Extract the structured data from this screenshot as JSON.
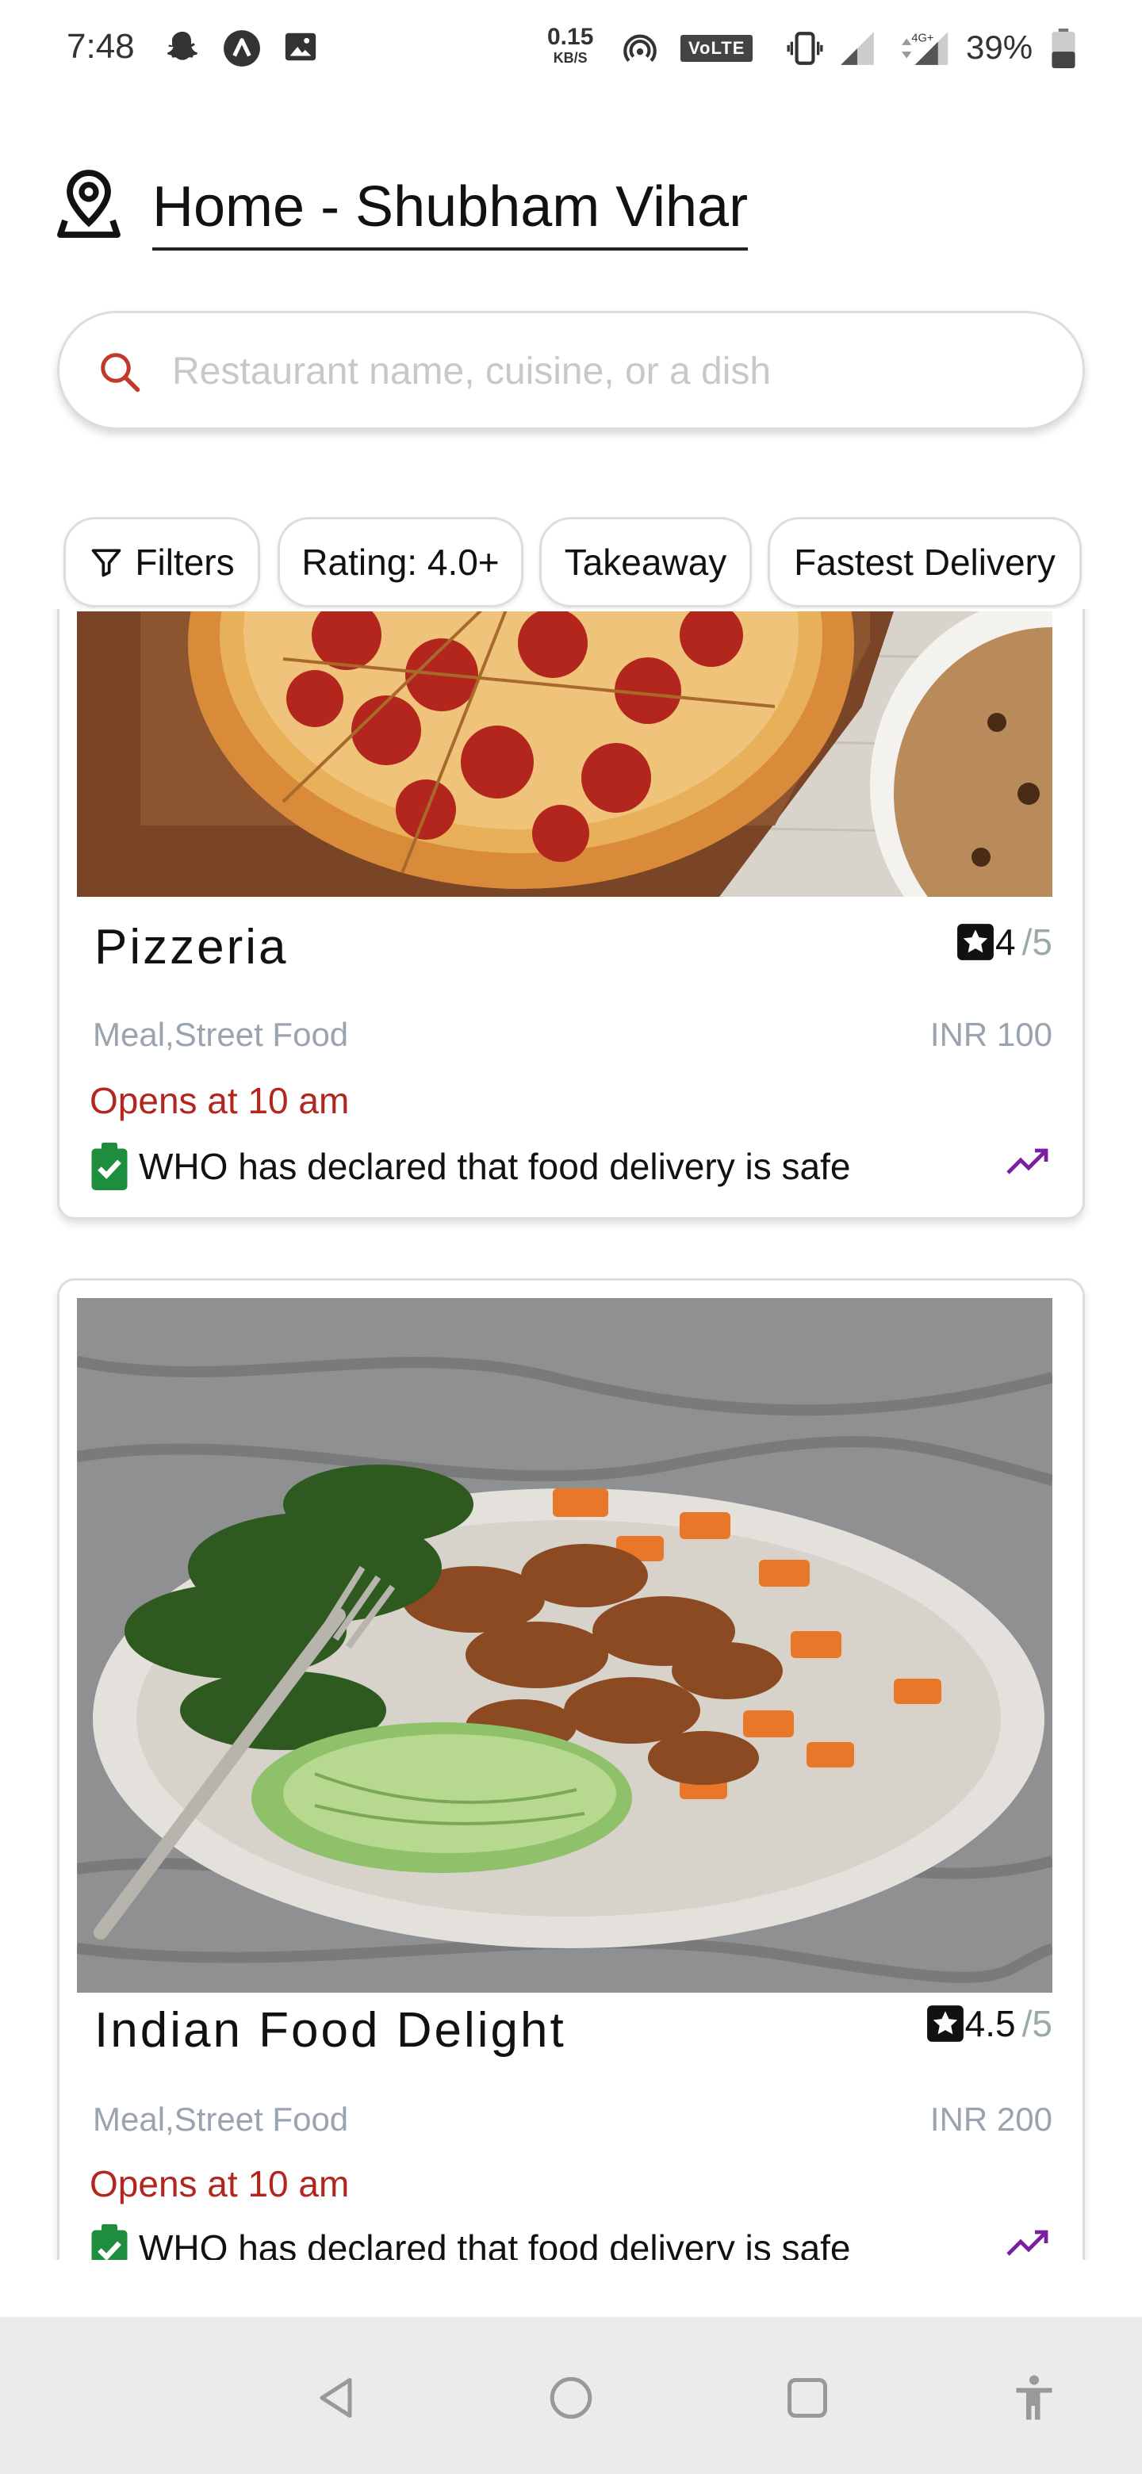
{
  "status": {
    "time": "7:48",
    "speed_value": "0.15",
    "speed_unit": "KB/S",
    "volte": "VoLTE",
    "battery": "39%"
  },
  "location": {
    "address": "Home - Shubham Vihar",
    "icon": "location-pin-icon"
  },
  "search": {
    "placeholder": "Restaurant name, cuisine, or a dish",
    "icon": "search-icon"
  },
  "filters": {
    "chips": [
      "Filters",
      "Rating: 4.0+",
      "Takeaway",
      "Fastest Delivery"
    ]
  },
  "restaurants": [
    {
      "name": "Pizzeria",
      "rating": "4",
      "rating_out_of": "/5",
      "cuisine": "Meal,Street Food",
      "price": "INR 100",
      "opens": "Opens at 10 am",
      "safety": "WHO has declared that food delivery is safe"
    },
    {
      "name": "Indian Food Delight",
      "rating": "4.5",
      "rating_out_of": "/5",
      "cuisine": "Meal,Street Food",
      "price": "INR 200",
      "opens": "Opens at 10 am",
      "safety": "WHO has declared that food delivery is safe"
    }
  ],
  "colors": {
    "accent_red": "#b3261e",
    "safety_green": "#1e8e3e",
    "trend_purple": "#7b1fa2"
  }
}
